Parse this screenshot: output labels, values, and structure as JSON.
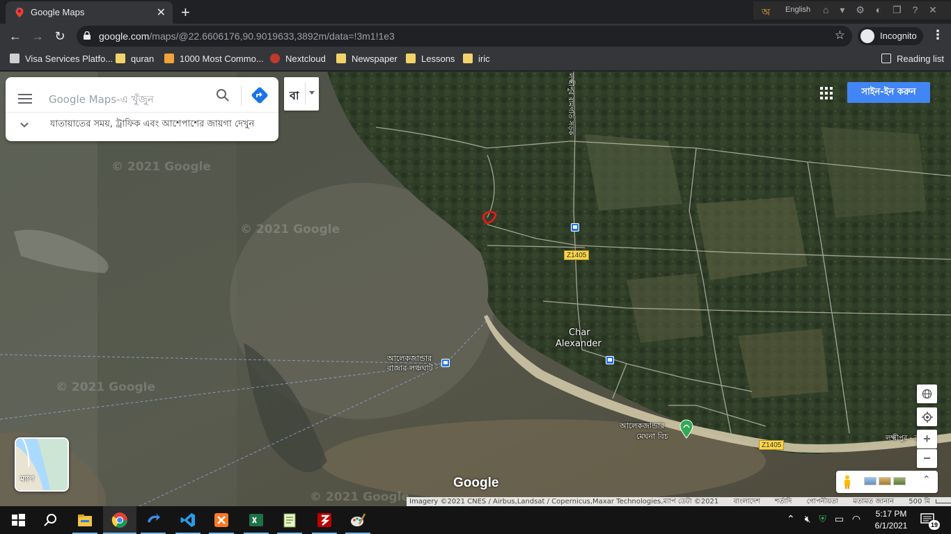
{
  "browser": {
    "tab_title": "Google Maps",
    "tab_close": "✕",
    "new_tab": "+",
    "url_host": "google.com",
    "url_path": "/maps/@22.6606176,90.9019633,3892m/data=!3m1!1e3",
    "profile_label": "Incognito",
    "language_widget": "English",
    "bookmarks": [
      {
        "label": "Visa Services Platfo...",
        "icon": "visa-icon"
      },
      {
        "label": "quran",
        "icon": "folder-icon"
      },
      {
        "label": "1000 Most Commo...",
        "icon": "document-icon"
      },
      {
        "label": "Nextcloud",
        "icon": "nextcloud-icon"
      },
      {
        "label": "Newspaper",
        "icon": "folder-icon"
      },
      {
        "label": "Lessons",
        "icon": "folder-icon"
      },
      {
        "label": "iric",
        "icon": "folder-icon"
      }
    ],
    "reading_list": "Reading list"
  },
  "maps": {
    "search_placeholder": "Google Maps-এ খুঁজুন",
    "hint_text": "যাতায়াতের সময়, ট্রাফিক এবং আশেপাশের জায়গা দেখুন",
    "layer_label": "বা",
    "signin_label": "সাইন-ইন করুন",
    "place_char_alexander_1": "Char",
    "place_char_alexander_2": "Alexander",
    "ghat_label_1": "আলেকজান্ডার",
    "ghat_label_2": "বাজার লঞ্চঘাট",
    "beach_label_1": "আলেকজান্ডার",
    "beach_label_2": "মেঘনা বিচ",
    "lakshmipur_label": "লক্ষ্মীপুর - র",
    "road_vertical_label": "লক্ষ্মীপুর রামগতি সড়ক",
    "road_shield_1": "Z1405",
    "road_shield_2": "Z1405",
    "watermarks": [
      "© 2021 Google",
      "© 2021 Google",
      "© 2021 Google",
      "© 2021 Google"
    ],
    "minimap_label": "ম্যাপ",
    "google_logo": "Google",
    "attribution": "Imagery ©2021 CNES / Airbus,Landsat / Copernicus,Maxar Technologies,ম্যাপ ডেটা ©2021",
    "footer_links": [
      "বাংলাদেশ",
      "শর্তাদি",
      "গোপনীয়তা",
      "মতামত জানান"
    ],
    "scale_label": "500 মি",
    "zoom_in": "+",
    "zoom_out": "−"
  },
  "taskbar": {
    "apps": [
      "file-explorer-icon",
      "chrome-icon",
      "app-arrow-icon",
      "vscode-icon",
      "xampp-icon",
      "excel-icon",
      "notepad-icon",
      "filezilla-icon",
      "paint-icon"
    ],
    "time": "5:17 PM",
    "date": "6/1/2021",
    "notification_count": "19"
  }
}
